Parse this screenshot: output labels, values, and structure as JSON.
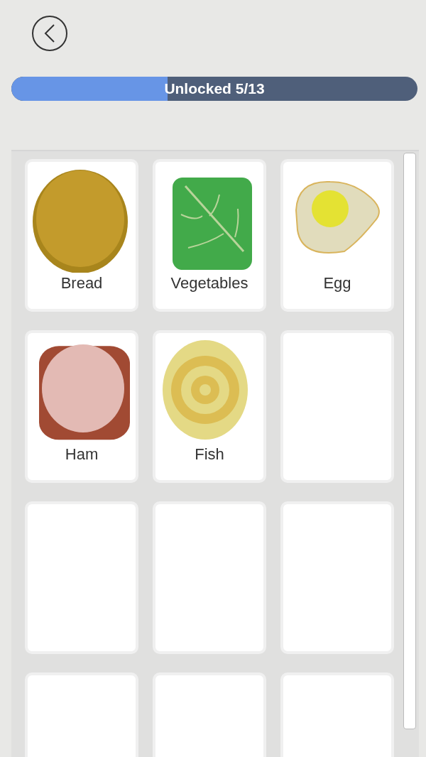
{
  "progress": {
    "label": "Unlocked 5/13",
    "level": 0.385
  },
  "items": [
    {
      "kind": "bread",
      "name": "Bread"
    },
    {
      "kind": "vegetables",
      "name": "Vegetables"
    },
    {
      "kind": "egg",
      "name": "Egg"
    },
    {
      "kind": "ham",
      "name": "Ham"
    },
    {
      "kind": "fish",
      "name": "Fish"
    },
    {
      "kind": "locked"
    },
    {
      "kind": "locked"
    },
    {
      "kind": "locked"
    },
    {
      "kind": "locked"
    },
    {
      "kind": "locked"
    },
    {
      "kind": "locked"
    },
    {
      "kind": "locked"
    }
  ]
}
